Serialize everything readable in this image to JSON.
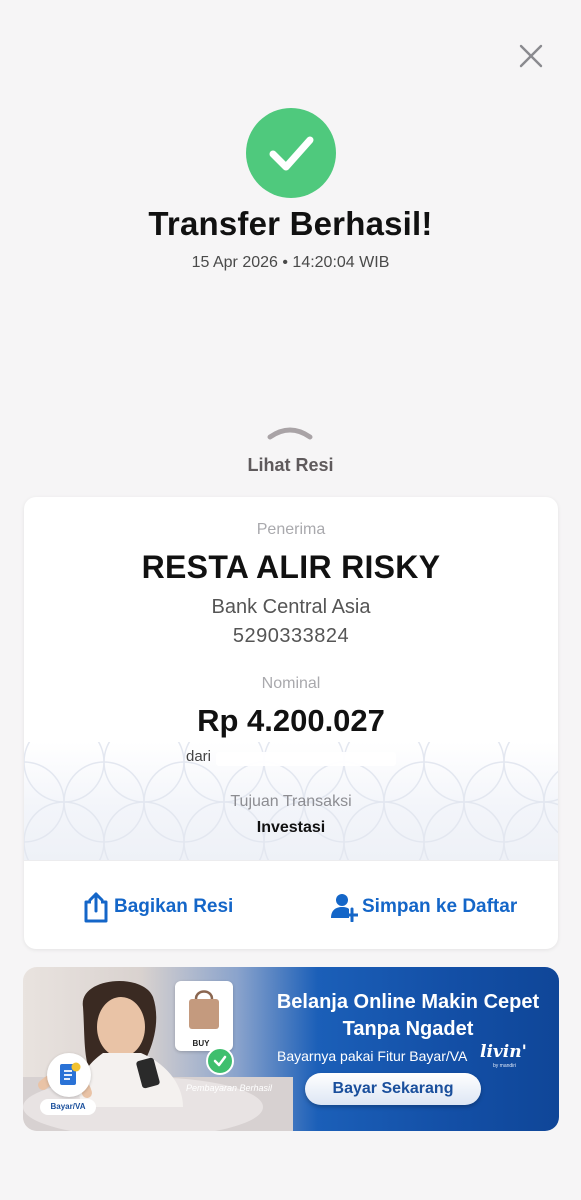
{
  "header": {
    "close_icon": "close-icon"
  },
  "status": {
    "icon": "checkmark-icon",
    "title": "Transfer Berhasil!",
    "datetime": "15 Apr 2026 • 14:20:04 WIB"
  },
  "toggle": {
    "icon": "chevron-up-icon",
    "label": "Lihat Resi"
  },
  "receipt": {
    "recipient_label": "Penerima",
    "recipient_name": "RESTA ALIR RISKY",
    "bank_name": "Bank Central Asia",
    "account_number": "5290333824",
    "amount_label": "Nominal",
    "amount": "Rp 4.200.027",
    "from_label": "dari",
    "purpose_label": "Tujuan Transaksi",
    "purpose_value": "Investasi",
    "share_label": "Bagikan Resi",
    "share_icon": "share-icon",
    "save_label": "Simpan ke Daftar",
    "save_icon": "add-contact-icon"
  },
  "promo_banner": {
    "headline_1": "Belanja Online Makin Cepet",
    "headline_2": "Tanpa Ngadet",
    "subtitle": "Bayarnya pakai Fitur Bayar/VA",
    "brand": "livin'",
    "brand_small": "by mandiri",
    "cta": "Bayar Sekarang",
    "va_label": "Bayar/VA",
    "buy_label": "BUY",
    "paid_label": "Pembayaran Berhasil"
  },
  "colors": {
    "success": "#4fc97d",
    "accent": "#1466c8",
    "background": "#f6f5f6"
  }
}
